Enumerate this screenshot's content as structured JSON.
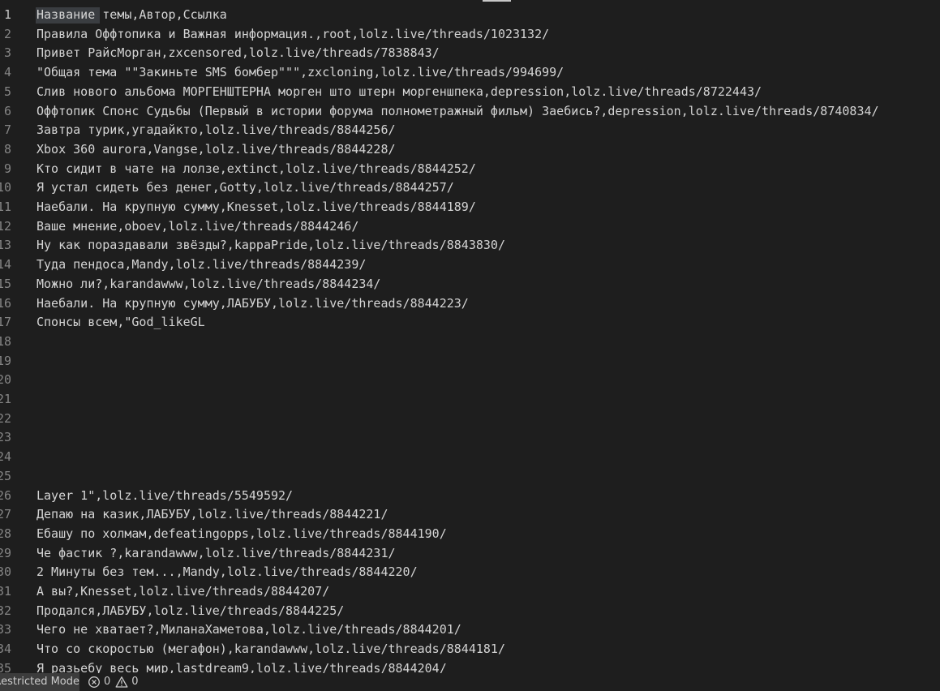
{
  "editor": {
    "current_line": 1,
    "lines": [
      {
        "n": "1",
        "text": "Название темы,Автор,Ссылка"
      },
      {
        "n": "2",
        "text": "Правила Оффтопика и Важная информация.,root,lolz.live/threads/1023132/"
      },
      {
        "n": "3",
        "text": "Привет РайсМорган,zxcensored,lolz.live/threads/7838843/"
      },
      {
        "n": "4",
        "text": "\"Общая тема \"\"Закиньте SMS бомбер\"\"\",zxcloning,lolz.live/threads/994699/"
      },
      {
        "n": "5",
        "text": "Слив нового альбома МОРГЕНШТЕРНА морген што штерн моргеншпека,depression,lolz.live/threads/8722443/"
      },
      {
        "n": "6",
        "text": "Оффтопик Спонс Судьбы (Первый в истории форума полнометражный фильм) Заебись?,depression,lolz.live/threads/8740834/"
      },
      {
        "n": "7",
        "text": "Завтра турик,угадайкто,lolz.live/threads/8844256/"
      },
      {
        "n": "8",
        "text": "Xbox 360 aurora,Vangse,lolz.live/threads/8844228/"
      },
      {
        "n": "9",
        "text": "Кто сидит в чате на лолзе,extinct,lolz.live/threads/8844252/"
      },
      {
        "n": "10",
        "text": "Я устал сидеть без денег,Gotty,lolz.live/threads/8844257/"
      },
      {
        "n": "11",
        "text": "Наебали. На крупную сумму,Knesset,lolz.live/threads/8844189/"
      },
      {
        "n": "12",
        "text": "Ваше мнение,oboev,lolz.live/threads/8844246/"
      },
      {
        "n": "13",
        "text": "Ну как пораздавали звёзды?,kappaPride,lolz.live/threads/8843830/"
      },
      {
        "n": "14",
        "text": "Туда пендоса,Mandy,lolz.live/threads/8844239/"
      },
      {
        "n": "15",
        "text": "Можно ли?,karandawww,lolz.live/threads/8844234/"
      },
      {
        "n": "16",
        "text": "Наебали. На крупную сумму,ЛАБУБУ,lolz.live/threads/8844223/"
      },
      {
        "n": "17",
        "text": "Спонсы всем,\"God_likeGL"
      },
      {
        "n": "18",
        "text": ""
      },
      {
        "n": "19",
        "text": ""
      },
      {
        "n": "20",
        "text": ""
      },
      {
        "n": "21",
        "text": ""
      },
      {
        "n": "22",
        "text": ""
      },
      {
        "n": "23",
        "text": ""
      },
      {
        "n": "24",
        "text": ""
      },
      {
        "n": "25",
        "text": ""
      },
      {
        "n": "26",
        "text": "Layer 1\",lolz.live/threads/5549592/"
      },
      {
        "n": "27",
        "text": "Депаю на казик,ЛАБУБУ,lolz.live/threads/8844221/"
      },
      {
        "n": "28",
        "text": "Ебашу по холмам,defeatingopps,lolz.live/threads/8844190/"
      },
      {
        "n": "29",
        "text": "Че фастик ?,karandawww,lolz.live/threads/8844231/"
      },
      {
        "n": "30",
        "text": "2 Минуты без тем...,Mandy,lolz.live/threads/8844220/"
      },
      {
        "n": "31",
        "text": "А вы?,Knesset,lolz.live/threads/8844207/"
      },
      {
        "n": "32",
        "text": "Продался,ЛАБУБУ,lolz.live/threads/8844225/"
      },
      {
        "n": "33",
        "text": "Чего не хватает?,МиланаХаметова,lolz.live/threads/8844201/"
      },
      {
        "n": "34",
        "text": "Что со скоростью (мегафон),karandawww,lolz.live/threads/8844181/"
      },
      {
        "n": "35",
        "text": "Я разьебу весь мир,lastdream9,lolz.live/threads/8844204/"
      }
    ]
  },
  "status_bar": {
    "restricted_mode": "Restricted Mode",
    "errors": "0",
    "warnings": "0",
    "error_icon": "error-circle-icon",
    "warning_icon": "warning-triangle-icon"
  },
  "colors": {
    "editor_background": "#1e1e1e",
    "text": "#d4d4d4",
    "line_number": "#858585",
    "word_highlight": "#3a3d41",
    "status_background": "#3c3c3c"
  }
}
